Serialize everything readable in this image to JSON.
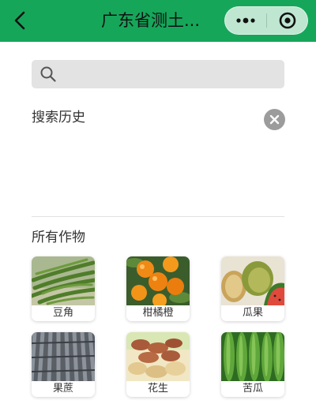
{
  "navbar": {
    "back_icon": "chevron-left-icon",
    "title": "广东省测土...",
    "more_icon": "more-dots-icon",
    "close_icon": "target-circle-icon",
    "color": "#16a65a"
  },
  "search": {
    "icon": "search-icon",
    "value": "",
    "placeholder": ""
  },
  "history": {
    "title": "搜索历史",
    "clear_icon": "clear-x-icon"
  },
  "crops": {
    "title": "所有作物",
    "items": [
      {
        "label": "豆角"
      },
      {
        "label": "柑橘橙"
      },
      {
        "label": "瓜果"
      },
      {
        "label": "果蔗"
      },
      {
        "label": "花生"
      },
      {
        "label": "苦瓜"
      }
    ]
  }
}
